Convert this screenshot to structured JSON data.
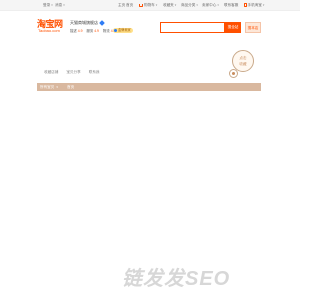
{
  "topbar": {
    "left_items": [
      "登录",
      "消息"
    ],
    "right_items": [
      "主页",
      "首页",
      "购物车",
      "收藏夹",
      "商品分类",
      "卖家中心",
      "联系客服",
      "网站导航"
    ],
    "cart_label": "购物车",
    "phone_label": "手机淘宝"
  },
  "header": {
    "logo_cn": "淘宝网",
    "logo_en": "Taobao.com",
    "shop_name": "天猫商城旗舰店",
    "ratings": {
      "desc_label": "描述",
      "desc_value": "4.9",
      "service_label": "服务",
      "service_value": "4.9",
      "logistics_label": "物流",
      "logistics_value": "4.9"
    },
    "badge_label": "金牌卖家"
  },
  "search": {
    "placeholder": "",
    "search_all_label": "搜全站",
    "search_shop_label": "搜本店"
  },
  "banner": {
    "links": [
      "收藏店铺",
      "宝贝分享",
      "联系我"
    ],
    "stamp_line1": "点击",
    "stamp_line2": "收藏"
  },
  "nav": {
    "all_label": "所有宝贝",
    "home_label": "首页"
  },
  "watermark": "链发发SEO",
  "colors": {
    "brand": "#ff5000",
    "nav_bg": "#d9b89f",
    "stamp": "#c9a98a"
  }
}
